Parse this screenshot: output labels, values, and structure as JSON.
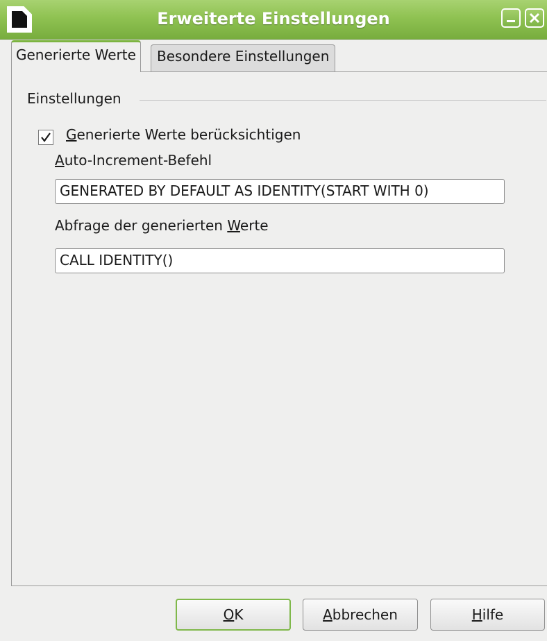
{
  "window": {
    "title": "Erweiterte Einstellungen",
    "accent_color": "#8fc252",
    "icons": {
      "app": "document-icon",
      "minimize": "minimize-icon",
      "close": "close-icon"
    }
  },
  "tabs": [
    {
      "label": "Generierte Werte",
      "active": true
    },
    {
      "label": "Besondere Einstellungen",
      "active": false
    }
  ],
  "settings": {
    "group_title": "Einstellungen",
    "checkbox": {
      "label_mnemonic": "G",
      "label_rest": "enerierte Werte berücksichtigen",
      "checked": true
    },
    "auto_increment": {
      "label_mnemonic": "A",
      "label_rest": "uto-Increment-Befehl",
      "value": "GENERATED BY DEFAULT AS IDENTITY(START WITH 0)"
    },
    "query": {
      "label_prefix": "Abfrage der generierten ",
      "label_mnemonic": "W",
      "label_rest": "erte",
      "value": "CALL IDENTITY()"
    }
  },
  "buttons": {
    "ok": {
      "mnemonic": "O",
      "rest": "K"
    },
    "cancel": {
      "mnemonic": "A",
      "rest": "bbrechen"
    },
    "help": {
      "mnemonic": "H",
      "rest": "ilfe"
    }
  }
}
